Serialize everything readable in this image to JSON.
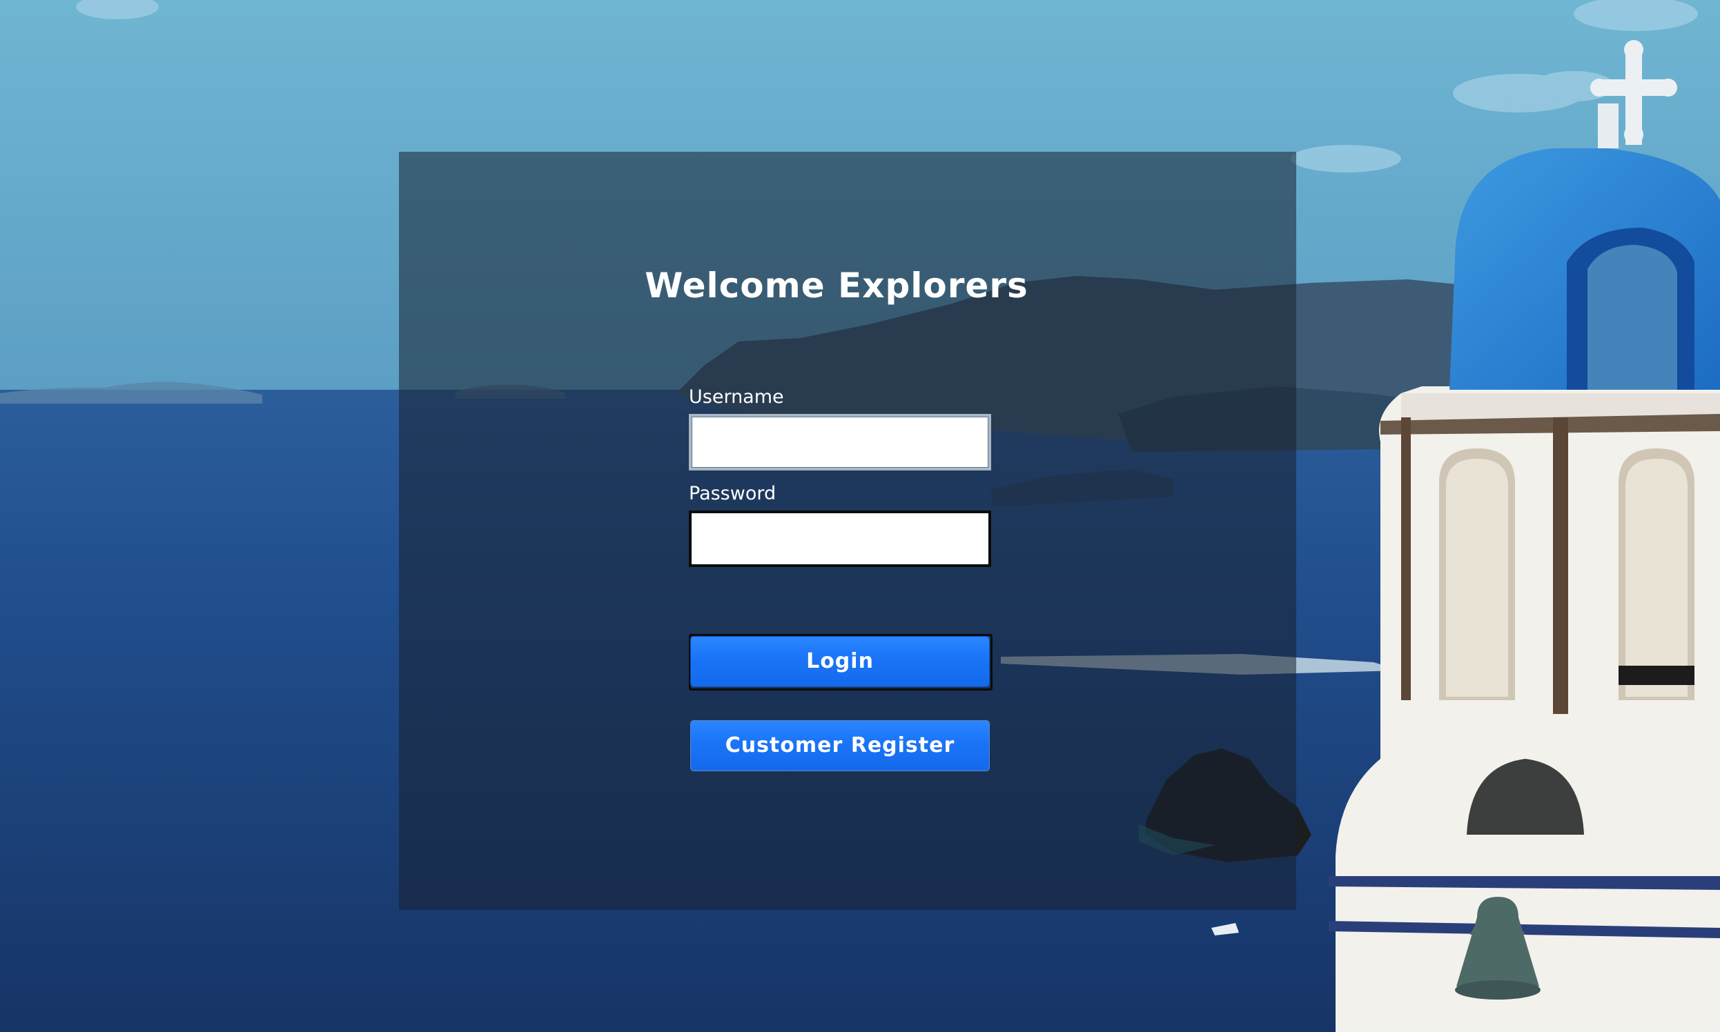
{
  "login_form": {
    "title": "Welcome Explorers",
    "username_label": "Username",
    "username_value": "",
    "password_label": "Password",
    "password_value": "",
    "login_button": "Login",
    "register_button": "Customer Register"
  },
  "colors": {
    "button_blue": "#1a74f7",
    "panel_overlay": "#172130",
    "text": "#ffffff"
  }
}
